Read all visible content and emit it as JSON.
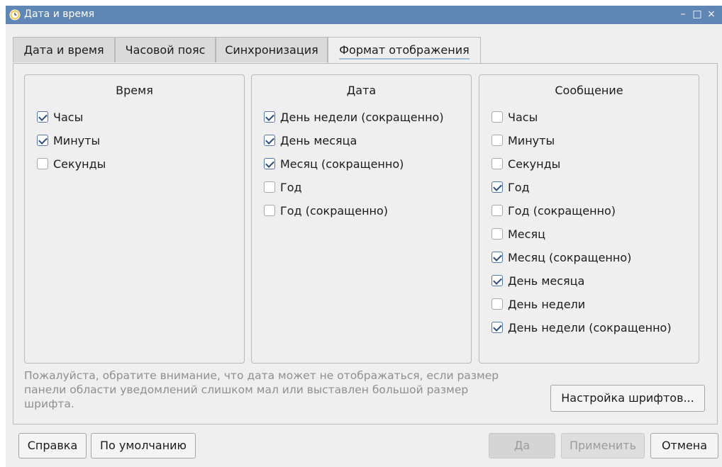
{
  "window": {
    "title": "Дата и время",
    "minimize": "–",
    "maximize": "□",
    "close": "×"
  },
  "tabs": [
    {
      "label": "Дата и время",
      "active": false
    },
    {
      "label": "Часовой пояс",
      "active": false
    },
    {
      "label": "Синхронизация",
      "active": false
    },
    {
      "label": "Формат отображения",
      "active": true
    }
  ],
  "groups": {
    "time": {
      "title": "Время",
      "items": [
        {
          "label": "Часы",
          "checked": true
        },
        {
          "label": "Минуты",
          "checked": true
        },
        {
          "label": "Секунды",
          "checked": false
        }
      ]
    },
    "date": {
      "title": "Дата",
      "items": [
        {
          "label": "День недели (сокращенно)",
          "checked": true
        },
        {
          "label": "День месяца",
          "checked": true
        },
        {
          "label": "Месяц (сокращенно)",
          "checked": true
        },
        {
          "label": "Год",
          "checked": false
        },
        {
          "label": "Год (сокращенно)",
          "checked": false
        }
      ]
    },
    "message": {
      "title": "Сообщение",
      "items": [
        {
          "label": "Часы",
          "checked": false
        },
        {
          "label": "Минуты",
          "checked": false
        },
        {
          "label": "Секунды",
          "checked": false
        },
        {
          "label": "Год",
          "checked": true
        },
        {
          "label": "Год (сокращенно)",
          "checked": false
        },
        {
          "label": "Месяц",
          "checked": false
        },
        {
          "label": "Месяц (сокращенно)",
          "checked": true
        },
        {
          "label": "День месяца",
          "checked": true
        },
        {
          "label": "День недели",
          "checked": false
        },
        {
          "label": "День недели (сокращенно)",
          "checked": true
        }
      ]
    }
  },
  "notice": {
    "line1": "Пожалуйста, обратите внимание, что дата может не отображаться, если размер",
    "line2": "панели области уведомлений слишком мал или выставлен большой размер",
    "line3": "шрифта."
  },
  "font_settings_button": "Настройка шрифтов...",
  "footer": {
    "help": "Справка",
    "defaults": "По умолчанию",
    "ok": "Да",
    "apply": "Применить",
    "cancel": "Отмена"
  },
  "colors": {
    "titlebar": "#5f86b5",
    "window_bg": "#efefef",
    "active_tab_underline": "#9fc0d8"
  }
}
